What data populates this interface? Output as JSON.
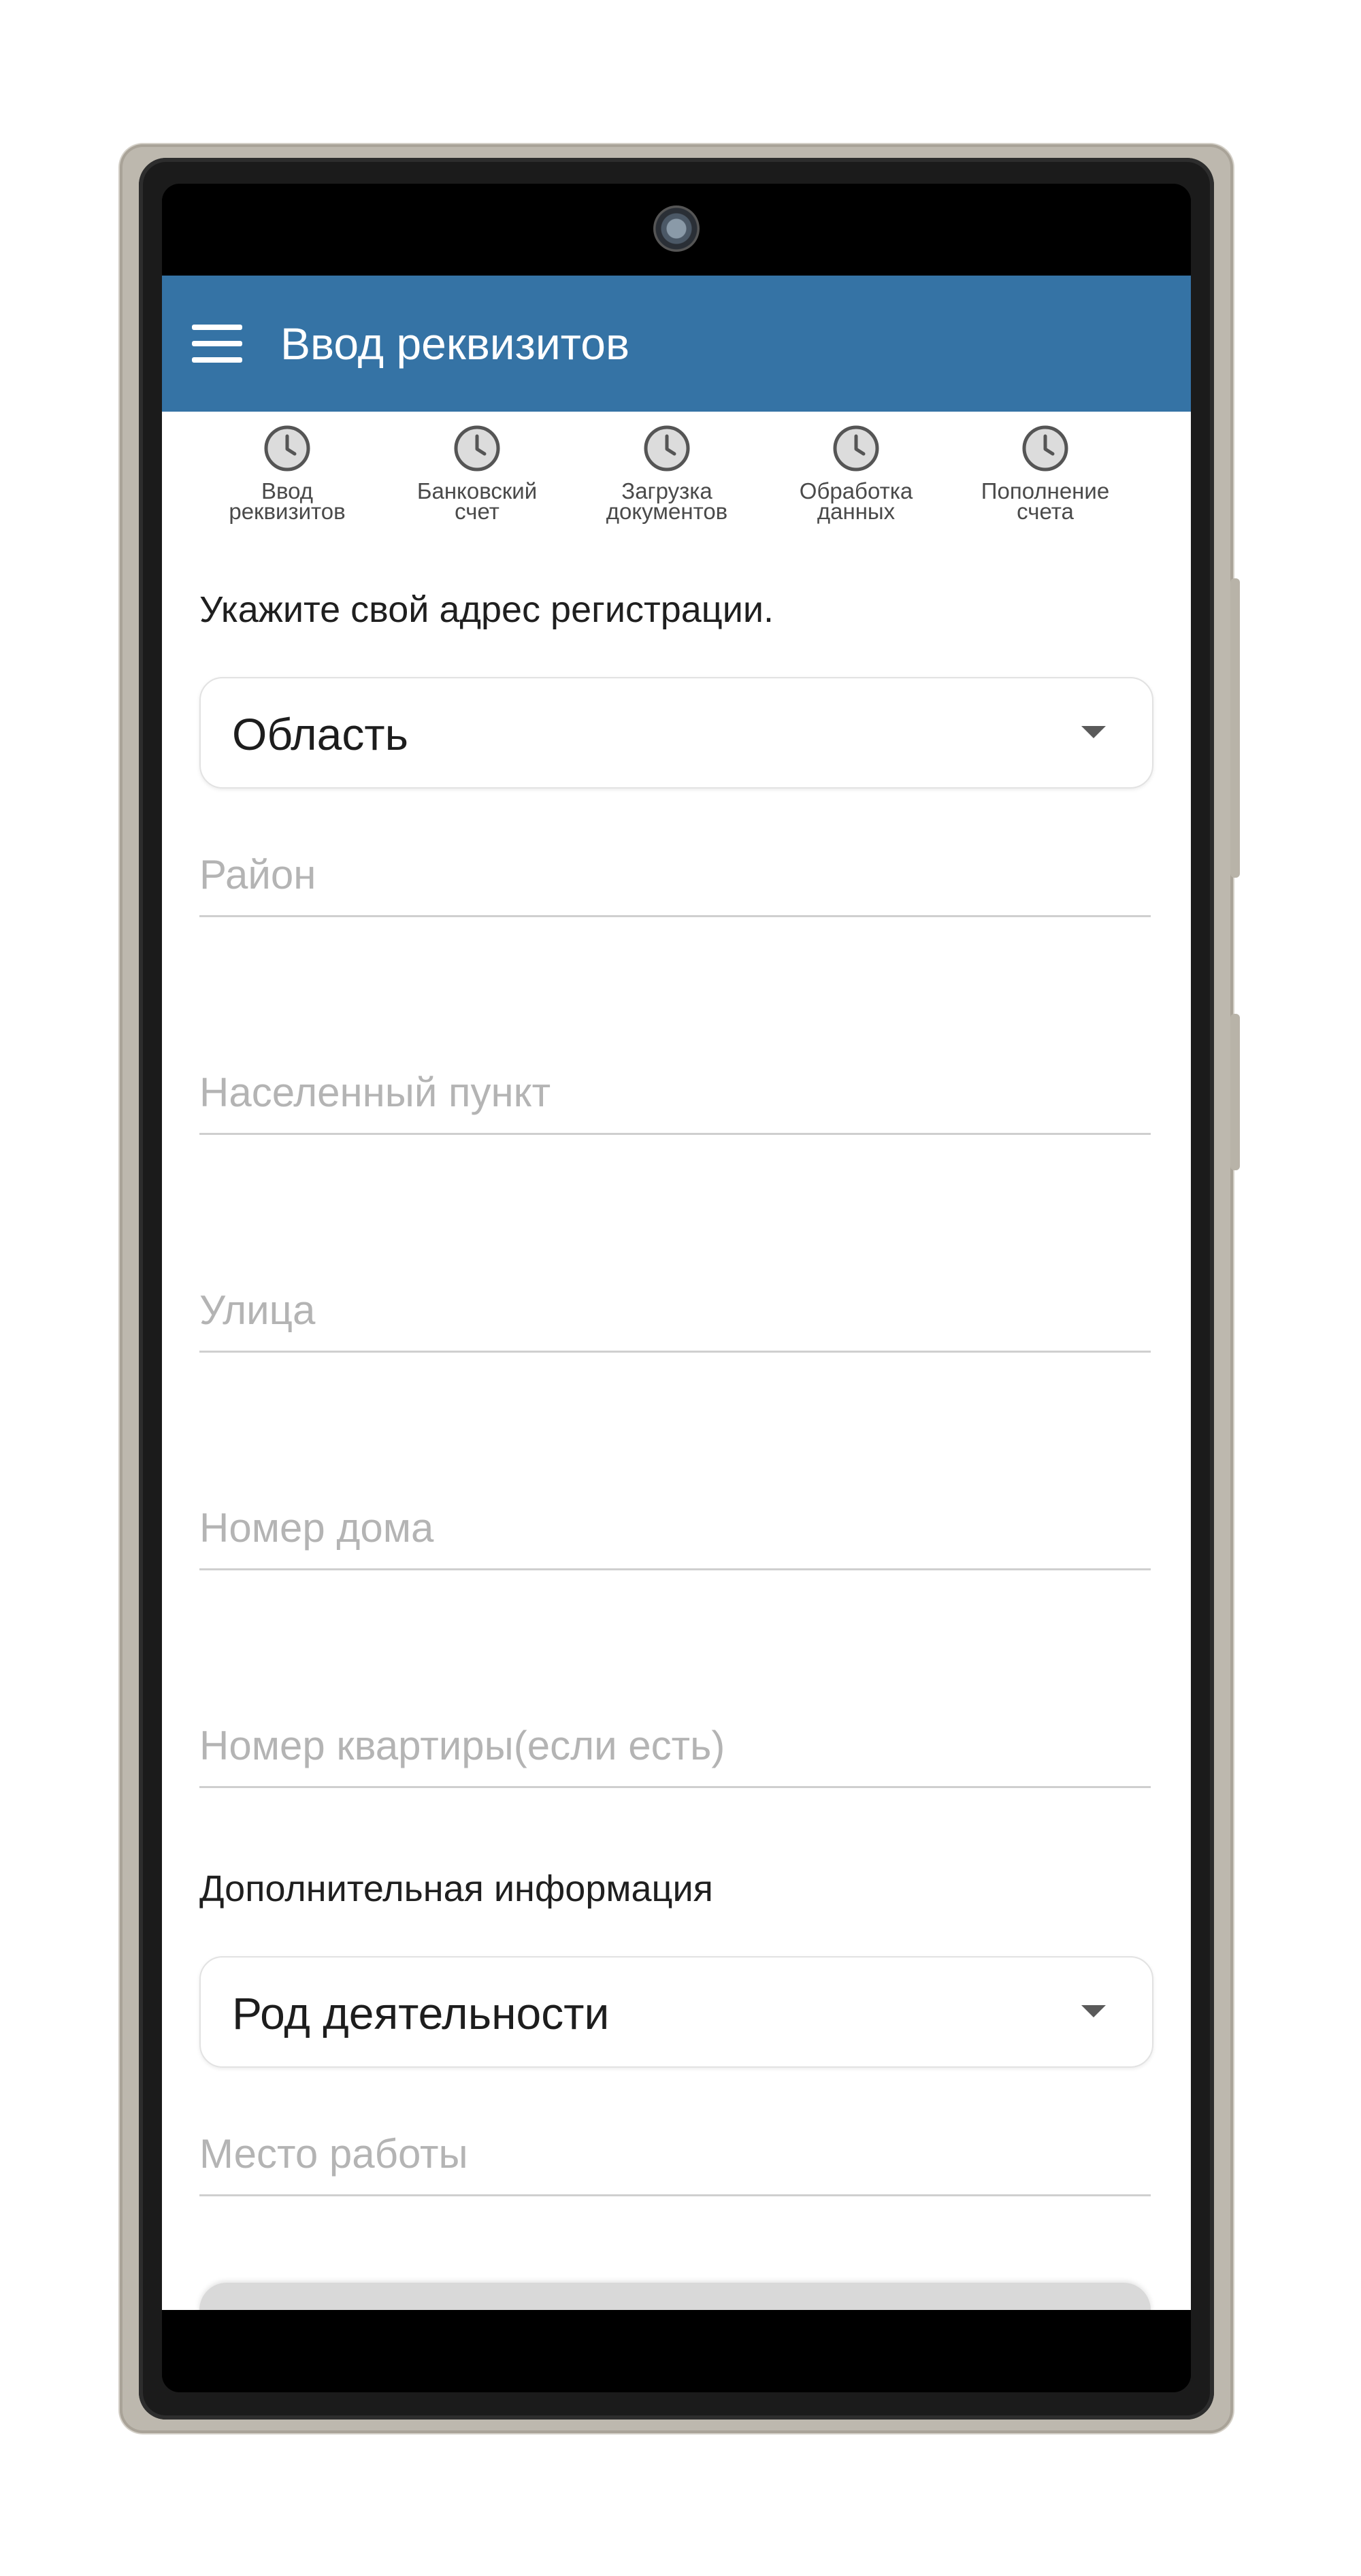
{
  "app_bar": {
    "title": "Ввод реквизитов",
    "menu_icon": "hamburger-menu-icon"
  },
  "stepper": {
    "icon": "clock-icon",
    "steps": [
      {
        "label": "Ввод\nреквизитов"
      },
      {
        "label": "Банковский\nсчет"
      },
      {
        "label": "Загрузка\nдокументов"
      },
      {
        "label": "Обработка\nданных"
      },
      {
        "label": "Пополнение\nсчета"
      }
    ]
  },
  "address": {
    "heading": "Укажите свой адрес регистрации.",
    "region_select": "Область",
    "district_placeholder": "Район",
    "locality_placeholder": "Населенный пункт",
    "street_placeholder": "Улица",
    "house_placeholder": "Номер дома",
    "apartment_placeholder": "Номер квартиры(если есть)"
  },
  "additional": {
    "heading": "Дополнительная информация",
    "occupation_select": "Род деятельности",
    "workplace_placeholder": "Место работы"
  },
  "colors": {
    "app_bar": "#3573a5",
    "step_icon_fill": "#dcdcdc",
    "step_icon_stroke": "#555555",
    "field_underline": "#cfcfcf",
    "placeholder": "#b4b4b4"
  }
}
